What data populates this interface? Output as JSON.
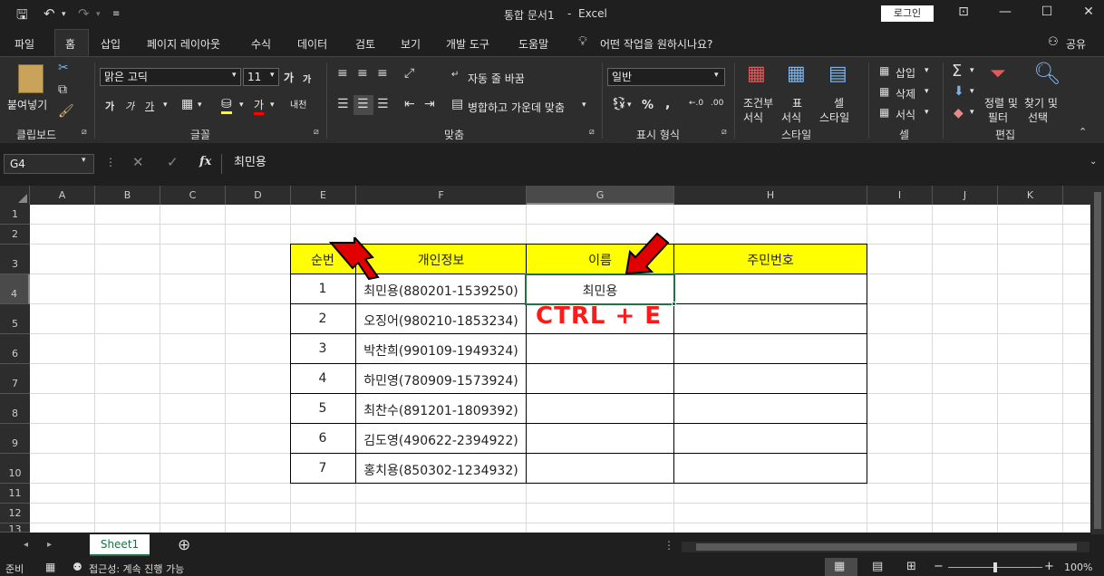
{
  "title": {
    "doc": "통합 문서1",
    "sep": "-",
    "app": "Excel",
    "login": "로그인"
  },
  "tabs": [
    "파일",
    "홈",
    "삽입",
    "페이지 레이아웃",
    "수식",
    "데이터",
    "검토",
    "보기",
    "개발 도구",
    "도움말"
  ],
  "tell_me": "어떤 작업을 원하시나요?",
  "share": "공유",
  "ribbon": {
    "clipboard": {
      "paste": "붙여넣기",
      "label": "클립보드"
    },
    "font": {
      "name": "맑은 고딕",
      "size": "11",
      "label": "글꼴"
    },
    "alignment": {
      "wrap": "자동 줄 바꿈",
      "merge": "병합하고 가운데 맞춤",
      "label": "맞춤"
    },
    "number": {
      "format": "일반",
      "label": "표시 형식"
    },
    "styles": {
      "cond1": "조건부",
      "cond2": "서식",
      "table1": "표",
      "table2": "서식",
      "cell1": "셀",
      "cell2": "스타일",
      "label": "스타일"
    },
    "cells": {
      "insert": "삽입",
      "delete": "삭제",
      "format": "서식",
      "label": "셀"
    },
    "editing": {
      "sort1": "정렬 및",
      "sort2": "필터",
      "find1": "찾기 및",
      "find2": "선택",
      "label": "편집"
    }
  },
  "formula": {
    "namebox": "G4",
    "content": "최민용"
  },
  "columns": [
    "A",
    "B",
    "C",
    "D",
    "E",
    "F",
    "G",
    "H",
    "I",
    "J",
    "K"
  ],
  "rows": [
    "1",
    "2",
    "3",
    "4",
    "5",
    "6",
    "7",
    "8",
    "9",
    "10",
    "11",
    "12",
    "13"
  ],
  "table": {
    "headers": [
      "순번",
      "개인정보",
      "이름",
      "주민번호"
    ],
    "rows": [
      {
        "num": "1",
        "info": "최민용(880201-1539250)",
        "name": "최민용"
      },
      {
        "num": "2",
        "info": "오징어(980210-1853234)",
        "name": ""
      },
      {
        "num": "3",
        "info": "박찬희(990109-1949324)",
        "name": ""
      },
      {
        "num": "4",
        "info": "하민영(780909-1573924)",
        "name": ""
      },
      {
        "num": "5",
        "info": "최찬수(891201-1809392)",
        "name": ""
      },
      {
        "num": "6",
        "info": "김도영(490622-2394922)",
        "name": ""
      },
      {
        "num": "7",
        "info": "홍치용(850302-1234932)",
        "name": ""
      }
    ]
  },
  "annotation": "CTRL + E",
  "sheet": "Sheet1",
  "status": {
    "ready": "준비",
    "access": "접근성: 계속 진행 가능",
    "zoom": "100%"
  }
}
